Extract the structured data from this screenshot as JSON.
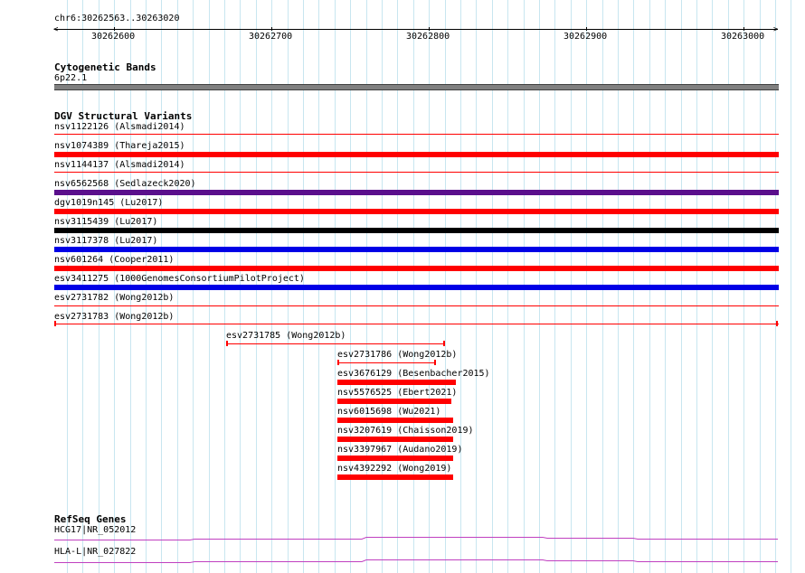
{
  "ruler": {
    "region": "chr6:30262563..30263020",
    "ticks": [
      "30262600",
      "30262700",
      "30262800",
      "30262900",
      "30263000"
    ]
  },
  "cytoband": {
    "title": "Cytogenetic Bands",
    "band": "6p22.1",
    "color": "#808080"
  },
  "dgv": {
    "title": "DGV Structural Variants",
    "variants": [
      {
        "label": "nsv1122126 (Alsmadi2014)",
        "color": "#ff0000",
        "style": "thin"
      },
      {
        "label": "nsv1074389 (Thareja2015)",
        "color": "#ff0000",
        "style": "thick"
      },
      {
        "label": "nsv1144137 (Alsmadi2014)",
        "color": "#ff0000",
        "style": "thin"
      },
      {
        "label": "nsv6562568 (Sedlazeck2020)",
        "color": "#5a0f8c",
        "style": "thick"
      },
      {
        "label": "dgv1019n145 (Lu2017)",
        "color": "#ff0000",
        "style": "thick"
      },
      {
        "label": "nsv3115439 (Lu2017)",
        "color": "#000000",
        "style": "thick"
      },
      {
        "label": "nsv3117378 (Lu2017)",
        "color": "#0000e6",
        "style": "thick"
      },
      {
        "label": "nsv601264 (Cooper2011)",
        "color": "#ff0000",
        "style": "thick"
      },
      {
        "label": "esv3411275 (1000GenomesConsortiumPilotProject)",
        "color": "#0000e6",
        "style": "thick"
      },
      {
        "label": "esv2731782 (Wong2012b)",
        "color": "#ff0000",
        "style": "thin"
      },
      {
        "label": "esv2731783 (Wong2012b)",
        "color": "#ff0000",
        "style": "capped"
      },
      {
        "label": "esv2731785 (Wong2012b)",
        "color": "#ff0000",
        "style": "capped"
      },
      {
        "label": "esv2731786 (Wong2012b)",
        "color": "#ff0000",
        "style": "capped"
      },
      {
        "label": "esv3676129 (Besenbacher2015)",
        "color": "#ff0000",
        "style": "thick"
      },
      {
        "label": "nsv5576525 (Ebert2021)",
        "color": "#ff0000",
        "style": "thick"
      },
      {
        "label": "nsv6015698 (Wu2021)",
        "color": "#ff0000",
        "style": "thick"
      },
      {
        "label": "nsv3207619 (Chaisson2019)",
        "color": "#ff0000",
        "style": "thick"
      },
      {
        "label": "nsv3397967 (Audano2019)",
        "color": "#ff0000",
        "style": "thick"
      },
      {
        "label": "nsv4392292 (Wong2019)",
        "color": "#ff0000",
        "style": "thick"
      }
    ]
  },
  "refseq": {
    "title": "RefSeq Genes",
    "color": "#c040c0",
    "genes": [
      {
        "label": "HCG17|NR_052012"
      },
      {
        "label": "HLA-L|NR_027822"
      }
    ]
  }
}
